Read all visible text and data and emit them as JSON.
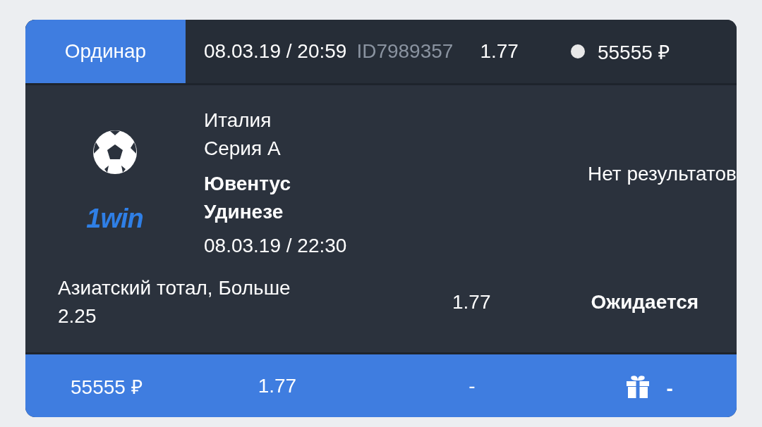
{
  "header": {
    "bet_type": "Ординар",
    "datetime": "08.03.19 / 20:59",
    "id": "ID7989357",
    "odds": "1.77",
    "amount": "55555 ₽"
  },
  "event": {
    "logo": "1win",
    "country": "Италия",
    "league": "Серия А",
    "home": "Ювентус",
    "away": "Удинезе",
    "datetime": "08.03.19 / 22:30",
    "result": "Нет результатов"
  },
  "bet": {
    "market": "Азиатский тотал, Больше 2.25",
    "odds": "1.77",
    "status": "Ожидается"
  },
  "footer": {
    "stake": "55555 ₽",
    "odds": "1.77",
    "payout": "-",
    "bonus": "-"
  }
}
